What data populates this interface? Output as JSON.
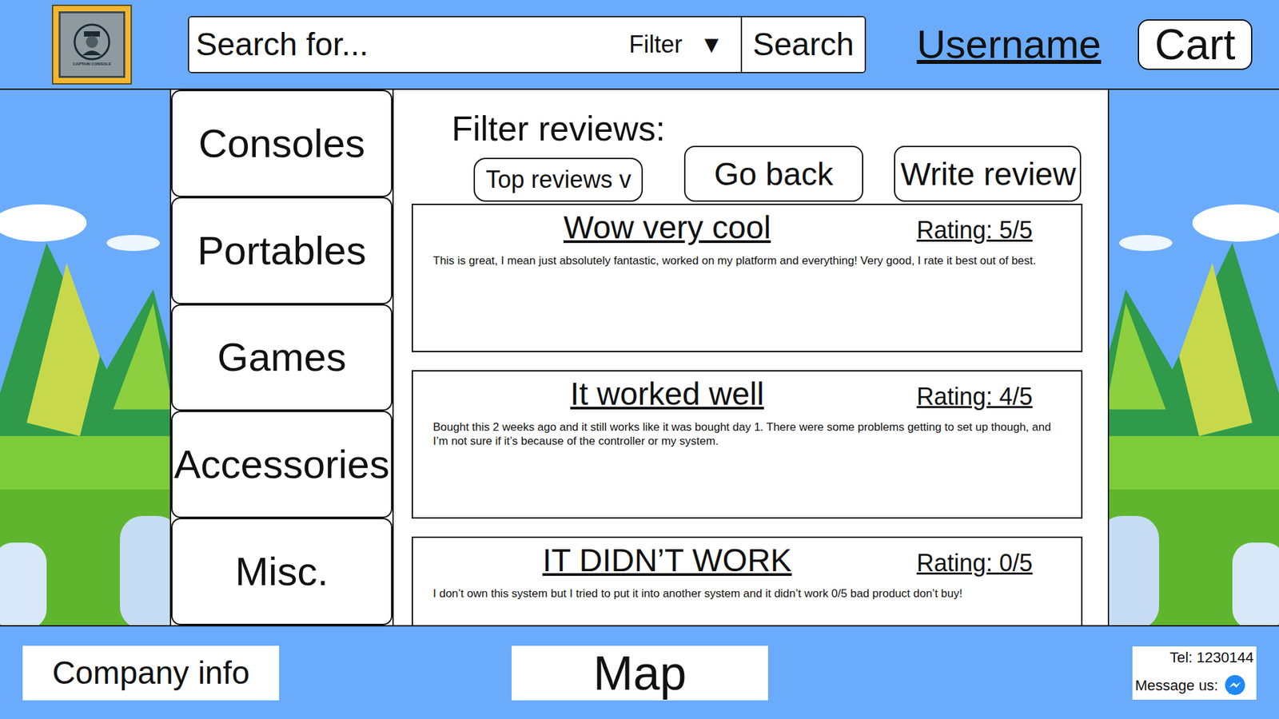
{
  "logo": {
    "caption": "CAPTAIN CONSOLE"
  },
  "search": {
    "placeholder": "Search for...",
    "filter": "Filter",
    "filter_arrow": "▼",
    "button": "Search"
  },
  "header": {
    "username": "Username",
    "cart": "Cart"
  },
  "sidebar": {
    "items": [
      "Consoles",
      "Portables",
      "Games",
      "Accessories",
      "Misc."
    ]
  },
  "reviews_toolbar": {
    "label": "Filter reviews:",
    "sort": "Top reviews v",
    "back": "Go back",
    "write": "Write review"
  },
  "reviews": [
    {
      "title": "Wow very cool",
      "rating": "Rating: 5/5",
      "body": "This is great, I mean just absolutely fantastic, worked on my platform and everything! Very good, I rate it best out of best."
    },
    {
      "title": "It worked well",
      "rating": "Rating: 4/5",
      "body": "Bought this 2 weeks ago and it still works like it was bought day 1. There were some problems getting to set up though, and I’m not sure if it’s because of the controller or my system."
    },
    {
      "title": "IT DIDN’T WORK",
      "rating": "Rating: 0/5",
      "body": "I don’t own this system but I tried to put it into another system and it didn’t work 0/5 bad product don’t buy!"
    }
  ],
  "footer": {
    "company": "Company info",
    "map": "Map",
    "tel": "Tel: 1230144",
    "message": "Message us:"
  }
}
